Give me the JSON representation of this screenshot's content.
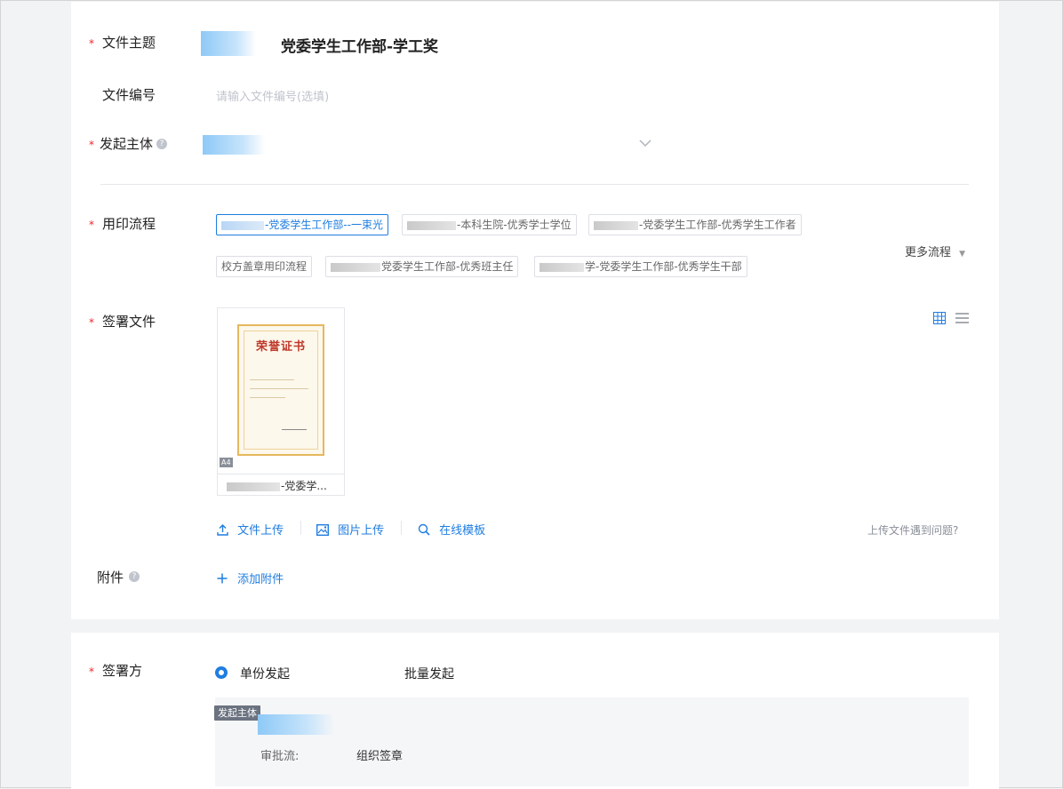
{
  "form": {
    "subject": {
      "label": "文件主题",
      "value": "党委学生工作部-学工奖"
    },
    "file_number": {
      "label": "文件编号",
      "placeholder": "请输入文件编号(选填)"
    },
    "initiator": {
      "label": "发起主体",
      "help": "?"
    },
    "process": {
      "label": "用印流程",
      "more": "更多流程",
      "tags": [
        {
          "text": "-党委学生工作部--一束光",
          "active": true
        },
        {
          "text": "-本科生院-优秀学士学位",
          "active": false
        },
        {
          "text": "-党委学生工作部-优秀学生工作者",
          "active": false
        },
        {
          "text": "校方盖章用印流程",
          "active": false
        },
        {
          "text": "党委学生工作部-优秀班主任",
          "active": false
        },
        {
          "text": "学-党委学生工作部-优秀学生干部",
          "active": false
        }
      ]
    },
    "sign_files": {
      "label": "签署文件",
      "thumbnail": {
        "badge": "A4",
        "caption": "-党委学...",
        "cert_title": "荣誉证书"
      },
      "actions": {
        "upload_file": "文件上传",
        "upload_image": "图片上传",
        "online_template": "在线模板"
      },
      "help_link": "上传文件遇到问题?"
    },
    "attachment": {
      "label": "附件",
      "help": "?",
      "add": "添加附件"
    }
  },
  "signers": {
    "label": "签署方",
    "options": {
      "single": "单份发起",
      "batch": "批量发起"
    },
    "panel": {
      "badge": "发起主体",
      "approval_label": "审批流:",
      "approval_value": "组织签章"
    }
  },
  "colors": {
    "accent": "#1f7de0",
    "required": "#f5222d"
  }
}
